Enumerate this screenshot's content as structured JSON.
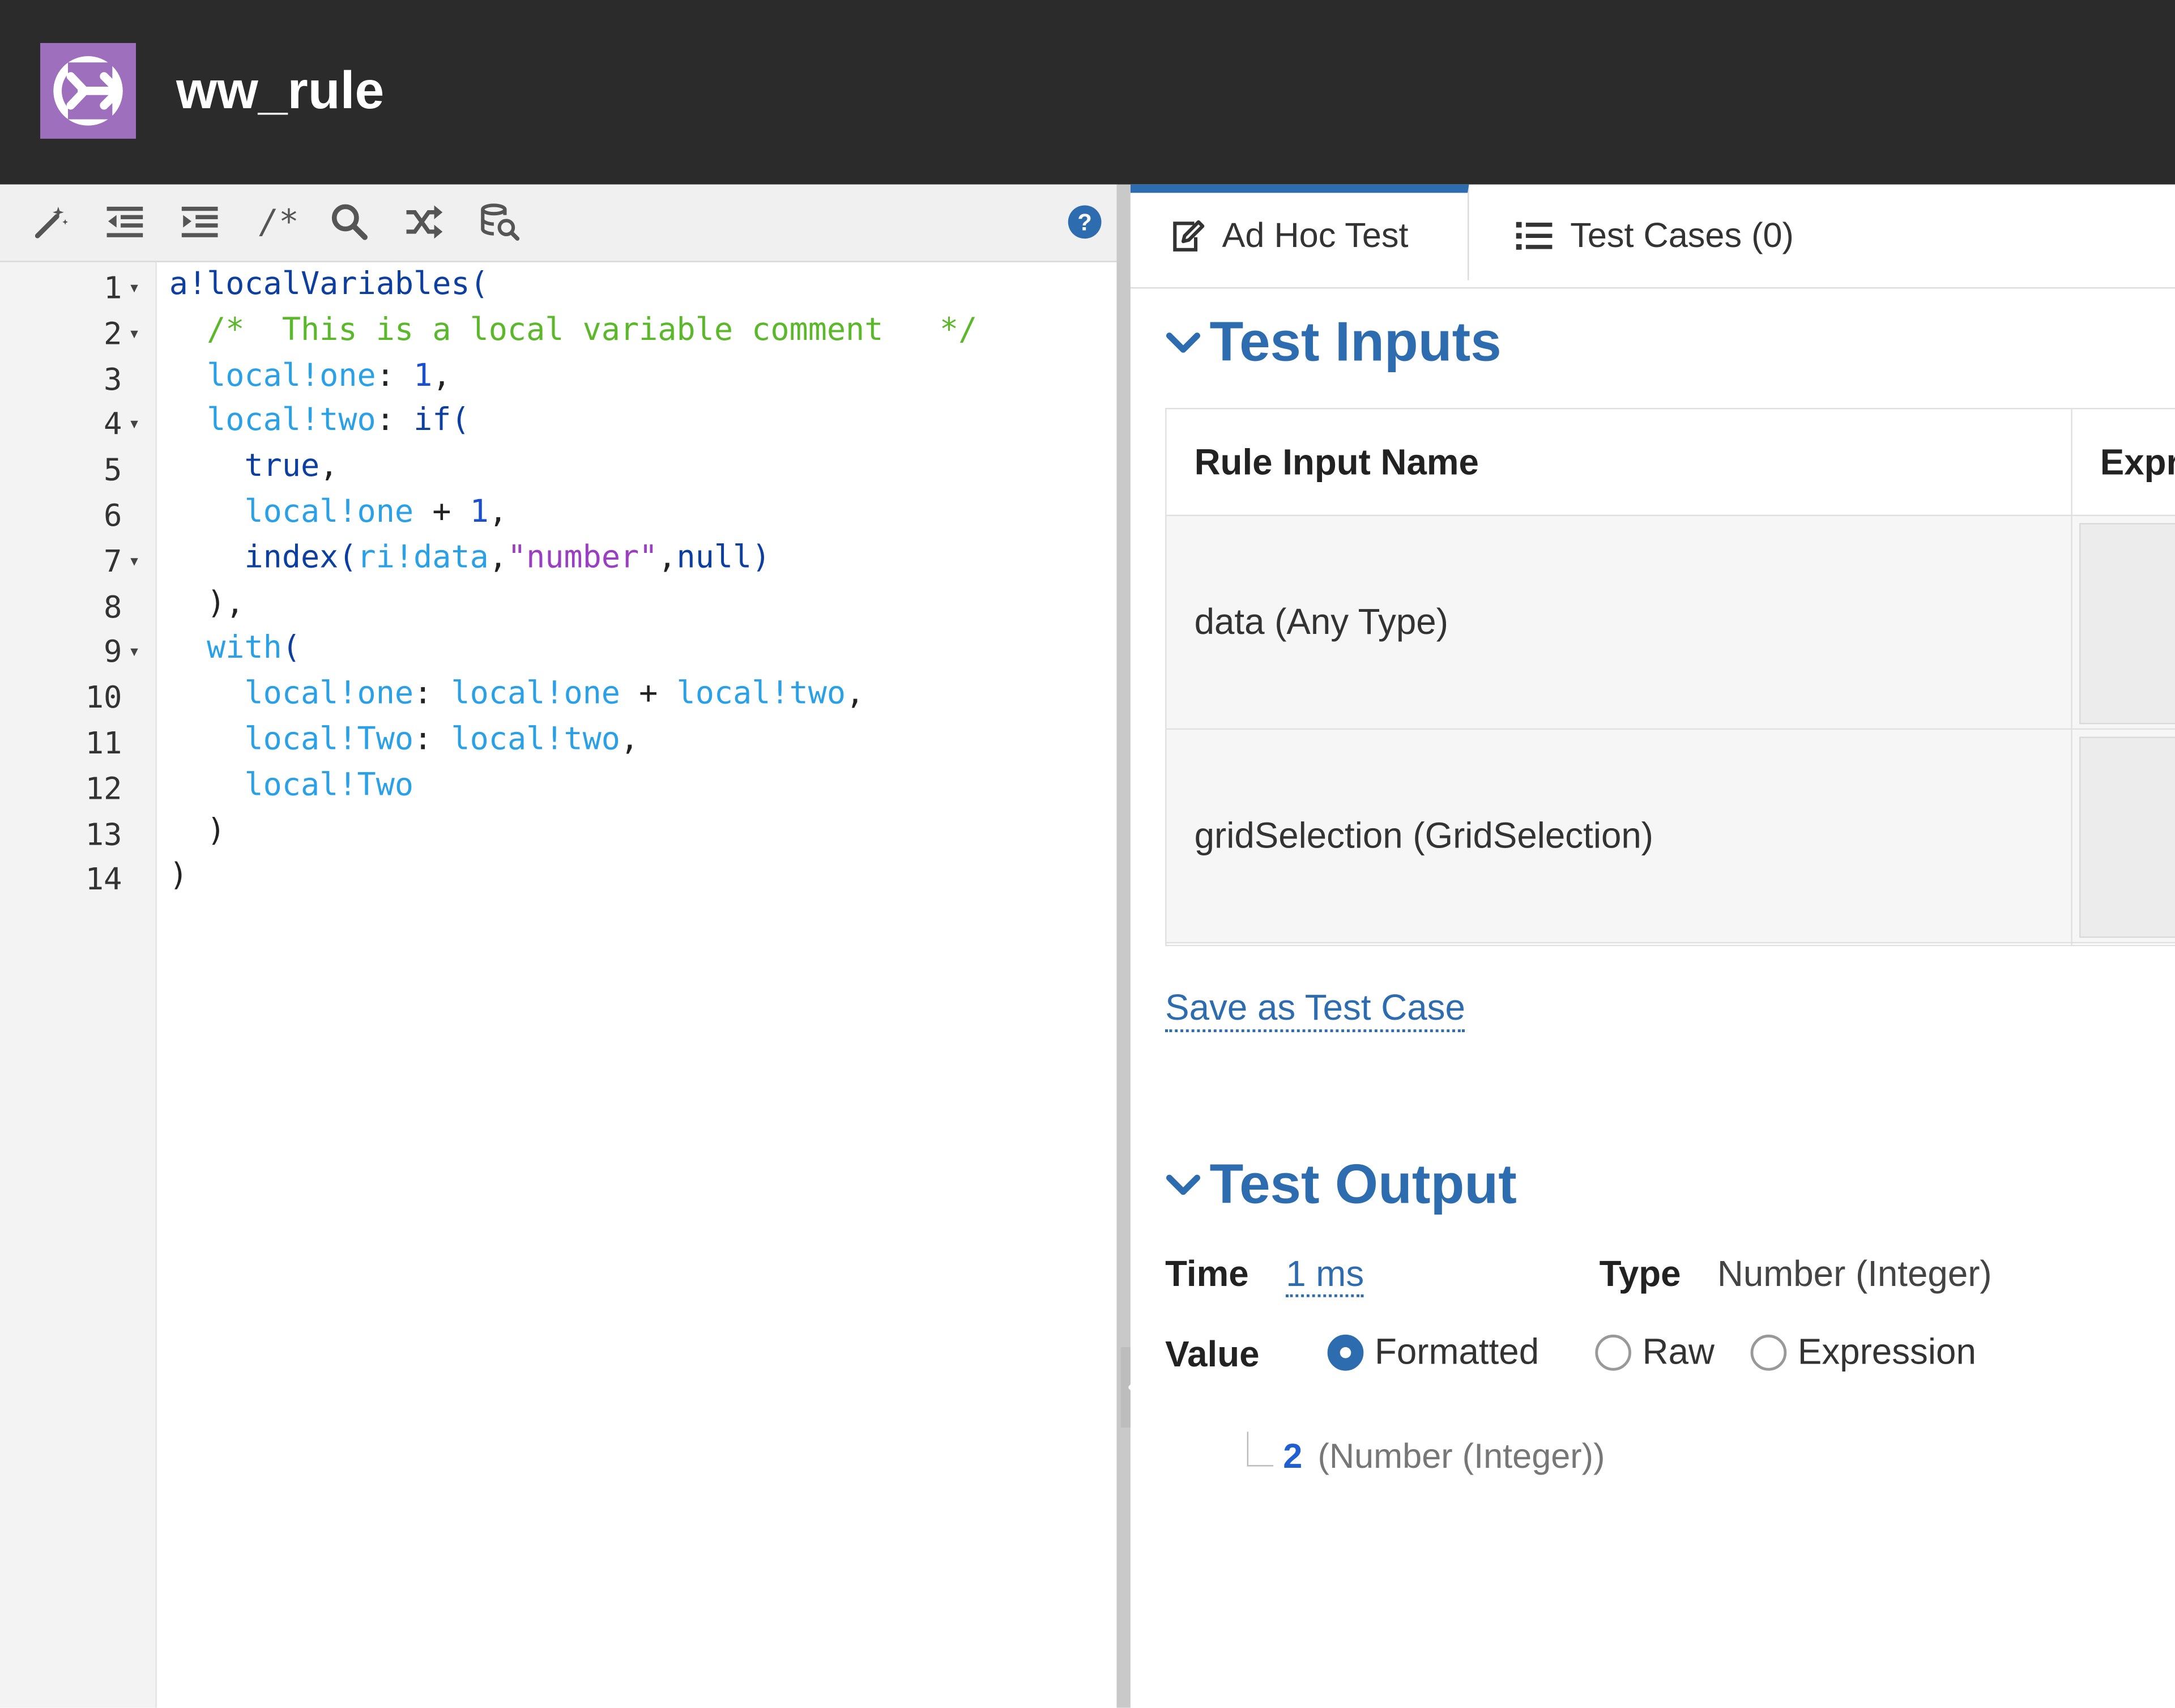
{
  "header": {
    "title": "ww_rule",
    "logo_icon": "arrow-right-logo-icon",
    "logo_color": "#9d6fbd"
  },
  "toolbar": {
    "buttons": [
      "magic-wand-icon",
      "outdent-icon",
      "indent-icon",
      "comment-icon",
      "search-icon",
      "shuffle-icon",
      "database-search-icon"
    ],
    "comment_label": "/*",
    "help_icon": "help-icon"
  },
  "editor": {
    "line_numbers": [
      "1",
      "2",
      "3",
      "4",
      "5",
      "6",
      "7",
      "8",
      "9",
      "10",
      "11",
      "12",
      "13",
      "14"
    ],
    "fold_lines": [
      "1",
      "2",
      "4",
      "7",
      "9"
    ],
    "code_lines": [
      [
        {
          "t": "a!localVariables",
          "c": "fn"
        },
        {
          "t": "(",
          "c": "fn"
        }
      ],
      [
        {
          "t": "  /*  This is a local variable comment   */",
          "c": "com"
        }
      ],
      [
        {
          "t": "  ",
          "c": "p"
        },
        {
          "t": "local!one",
          "c": "var"
        },
        {
          "t": ": ",
          "c": "p"
        },
        {
          "t": "1",
          "c": "num"
        },
        {
          "t": ",",
          "c": "p"
        }
      ],
      [
        {
          "t": "  ",
          "c": "p"
        },
        {
          "t": "local!two",
          "c": "var"
        },
        {
          "t": ": ",
          "c": "p"
        },
        {
          "t": "if",
          "c": "fn"
        },
        {
          "t": "(",
          "c": "fn"
        }
      ],
      [
        {
          "t": "    ",
          "c": "p"
        },
        {
          "t": "true",
          "c": "fn"
        },
        {
          "t": ",",
          "c": "p"
        }
      ],
      [
        {
          "t": "    ",
          "c": "p"
        },
        {
          "t": "local!one",
          "c": "var"
        },
        {
          "t": " + ",
          "c": "p"
        },
        {
          "t": "1",
          "c": "num"
        },
        {
          "t": ",",
          "c": "p"
        }
      ],
      [
        {
          "t": "    ",
          "c": "p"
        },
        {
          "t": "index",
          "c": "fn"
        },
        {
          "t": "(",
          "c": "fn"
        },
        {
          "t": "ri!data",
          "c": "var"
        },
        {
          "t": ",",
          "c": "p"
        },
        {
          "t": "\"number\"",
          "c": "str"
        },
        {
          "t": ",",
          "c": "p"
        },
        {
          "t": "null",
          "c": "fn"
        },
        {
          "t": ")",
          "c": "fn"
        }
      ],
      [
        {
          "t": "  ),",
          "c": "p"
        }
      ],
      [
        {
          "t": "  ",
          "c": "p"
        },
        {
          "t": "with",
          "c": "var"
        },
        {
          "t": "(",
          "c": "fn"
        }
      ],
      [
        {
          "t": "    ",
          "c": "p"
        },
        {
          "t": "local!one",
          "c": "var"
        },
        {
          "t": ": ",
          "c": "p"
        },
        {
          "t": "local!one",
          "c": "var"
        },
        {
          "t": " + ",
          "c": "p"
        },
        {
          "t": "local!two",
          "c": "var"
        },
        {
          "t": ",",
          "c": "p"
        }
      ],
      [
        {
          "t": "    ",
          "c": "p"
        },
        {
          "t": "local!Two",
          "c": "var"
        },
        {
          "t": ": ",
          "c": "p"
        },
        {
          "t": "local!two",
          "c": "var"
        },
        {
          "t": ",",
          "c": "p"
        }
      ],
      [
        {
          "t": "    ",
          "c": "p"
        },
        {
          "t": "local!Two",
          "c": "var"
        }
      ],
      [
        {
          "t": "  )",
          "c": "p"
        }
      ],
      [
        {
          "t": ")",
          "c": "p"
        }
      ]
    ]
  },
  "tabs": [
    {
      "label": "Ad Hoc Test",
      "icon": "edit-icon",
      "active": true
    },
    {
      "label": "Test Cases (0)",
      "icon": "list-icon",
      "active": false
    }
  ],
  "test_inputs": {
    "title": "Test Inputs",
    "columns": [
      "Rule Input Name",
      "Expr"
    ],
    "rows": [
      {
        "name": "data (Any Type)",
        "expression": ""
      },
      {
        "name": "gridSelection (GridSelection)",
        "expression": ""
      }
    ],
    "save_link": "Save as Test Case"
  },
  "test_output": {
    "title": "Test Output",
    "time_label": "Time",
    "time_value": "1 ms",
    "type_label": "Type",
    "type_value": "Number (Integer)",
    "value_label": "Value",
    "value_modes": [
      {
        "label": "Formatted",
        "selected": true
      },
      {
        "label": "Raw",
        "selected": false
      },
      {
        "label": "Expression",
        "selected": false
      }
    ],
    "result_value": "2",
    "result_type": "(Number (Integer))"
  },
  "colors": {
    "accent": "#2e6cb0",
    "header_bg": "#2b2b2b"
  }
}
